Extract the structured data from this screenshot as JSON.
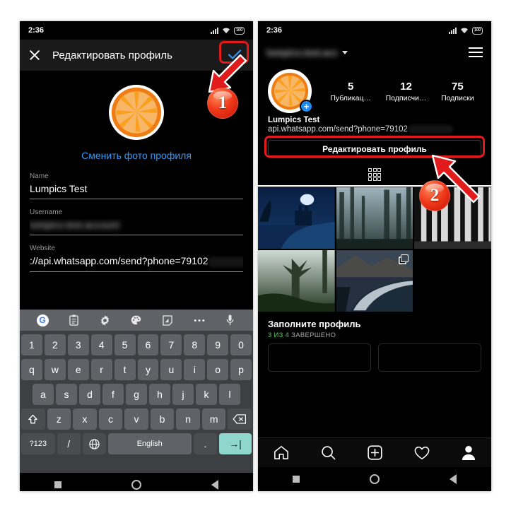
{
  "status_bar": {
    "time": "2:36",
    "battery": "100"
  },
  "left_screen": {
    "app_bar": {
      "title": "Редактировать профиль",
      "close_icon": "close-icon",
      "confirm_icon": "check-icon"
    },
    "change_photo_label": "Сменить фото профиля",
    "fields": [
      {
        "label": "Name",
        "value": "Lumpics Test",
        "redacted": false
      },
      {
        "label": "Username",
        "value": "lumpics.test.account",
        "redacted": true
      },
      {
        "label": "Website",
        "value": "://api.whatsapp.com/send?phone=79102",
        "redacted_tail": true
      }
    ],
    "keyboard": {
      "tools": [
        "google-icon",
        "clipboard-icon",
        "gear-icon",
        "palette-icon",
        "sticker-icon",
        "more-icon",
        "microphone-icon"
      ],
      "google_letter": "G",
      "row_numbers": [
        "1",
        "2",
        "3",
        "4",
        "5",
        "6",
        "7",
        "8",
        "9",
        "0"
      ],
      "row_top": [
        "q",
        "w",
        "e",
        "r",
        "t",
        "y",
        "u",
        "i",
        "o",
        "p"
      ],
      "row_mid": [
        "a",
        "s",
        "d",
        "f",
        "g",
        "h",
        "j",
        "k",
        "l"
      ],
      "row_low": [
        "z",
        "x",
        "c",
        "v",
        "b",
        "n",
        "m"
      ],
      "shift_label": "shift-icon",
      "backspace_label": "backspace-icon",
      "symbols_label": "?123",
      "slash_label": "/",
      "globe_label": "globe-icon",
      "space_label": "English",
      "period_label": ".",
      "enter_label": "→|"
    }
  },
  "right_screen": {
    "header": {
      "username": "lumpics.test.acc",
      "menu_icon": "hamburger-icon",
      "chevron_icon": "chevron-down-icon"
    },
    "stats": [
      {
        "value": "5",
        "label": "Публикац…"
      },
      {
        "value": "12",
        "label": "Подписчи…"
      },
      {
        "value": "75",
        "label": "Подписки"
      }
    ],
    "bio_name": "Lumpics Test",
    "bio_link": "api.whatsapp.com/send?phone=79102",
    "edit_profile_button": "Редактировать профиль",
    "tabs": [
      {
        "icon": "grid-icon",
        "active": true
      }
    ],
    "avatar_plus_icon": "plus-badge-icon",
    "complete_profile": {
      "title": "Заполните профиль",
      "progress_done": "3 ИЗ 4",
      "progress_rest": " ЗАВЕРШЕНО"
    },
    "bottom_nav": [
      "home-icon",
      "search-icon",
      "add-post-icon",
      "heart-icon",
      "profile-icon"
    ]
  },
  "android_nav": [
    "recents-icon",
    "home-icon",
    "back-icon"
  ],
  "annotations": [
    {
      "badge": "1",
      "target": "confirm-check-button"
    },
    {
      "badge": "2",
      "target": "profile-website-link"
    }
  ],
  "colors": {
    "accent_blue": "#3897f0",
    "annotation_red": "#e11b1b",
    "green": "#5ccf5c",
    "enter_key": "#8fd6cd"
  }
}
